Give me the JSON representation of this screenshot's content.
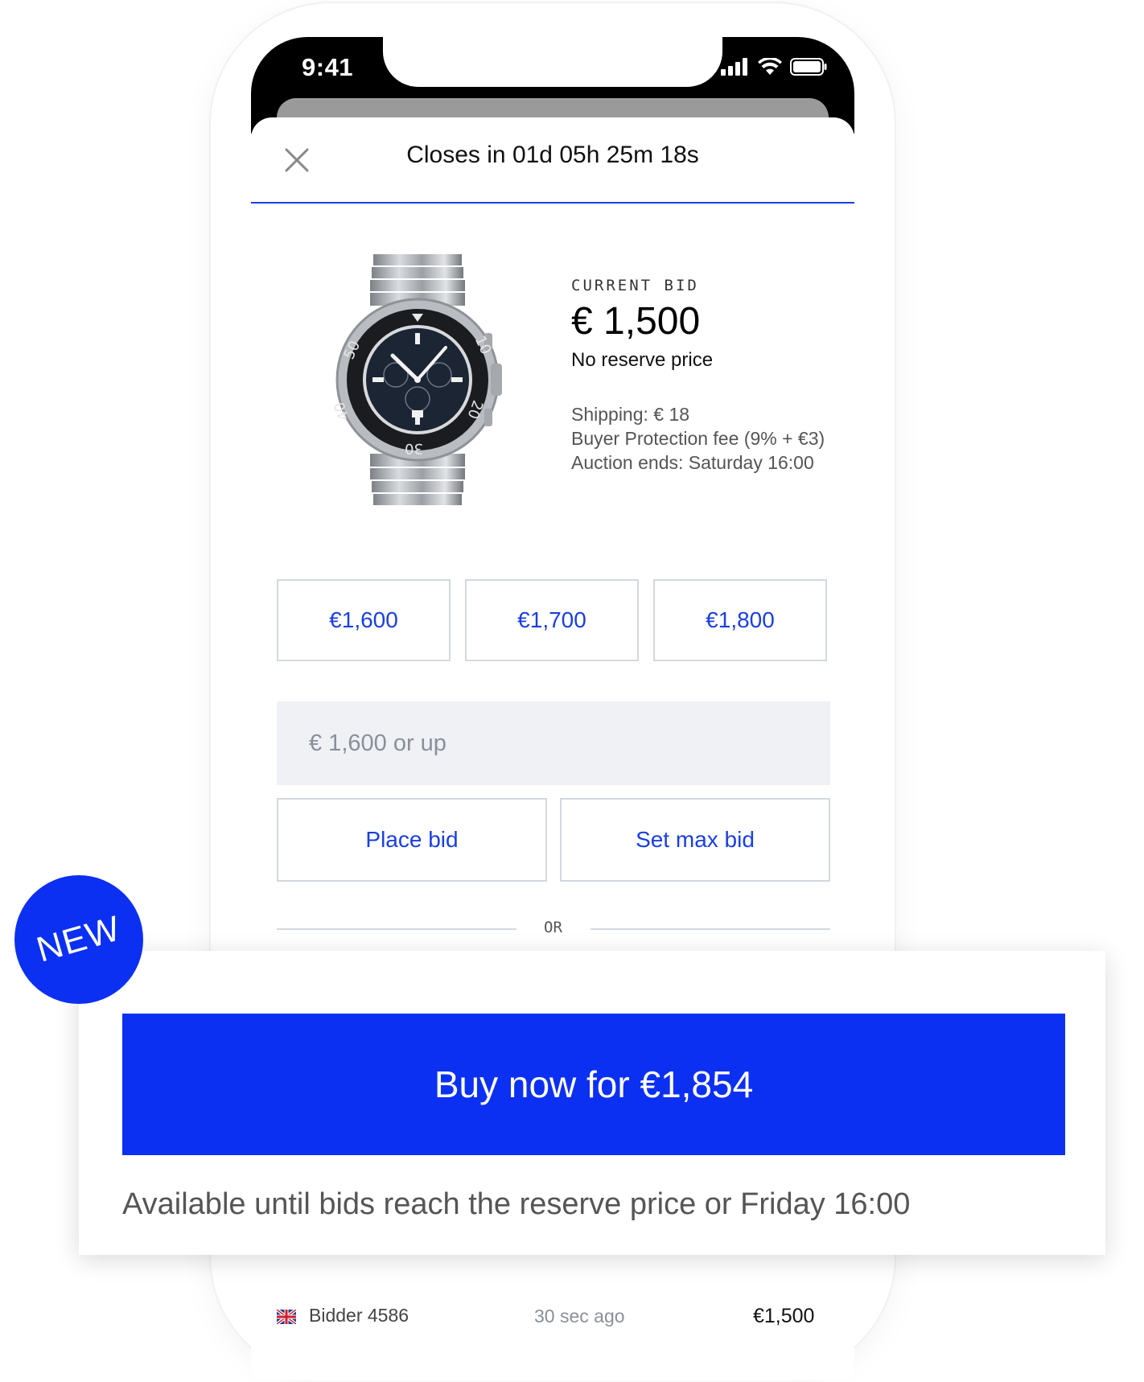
{
  "status_bar": {
    "time": "9:41",
    "icons": [
      "cellular-signal-icon",
      "wifi-icon",
      "battery-icon"
    ]
  },
  "header": {
    "close_icon": "close-icon",
    "countdown": "Closes in 01d 05h 25m 18s",
    "accent_color": "#1a3fe0"
  },
  "product": {
    "image_icon": "wristwatch-icon"
  },
  "bid_info": {
    "current_bid_label": "CURRENT BID",
    "current_bid_value": "€ 1,500",
    "reserve_text": "No reserve price",
    "shipping": "Shipping: € 18",
    "buyer_protection": "Buyer Protection fee (9% + €3)",
    "auction_ends": "Auction ends: Saturday 16:00"
  },
  "quick_bids": [
    "€1,600",
    "€1,700",
    "€1,800"
  ],
  "bid_input": {
    "placeholder": "€ 1,600 or up",
    "value": ""
  },
  "actions": {
    "place_bid": "Place bid",
    "set_max_bid": "Set max bid"
  },
  "divider": {
    "or_text": "OR"
  },
  "buy_now": {
    "badge": "NEW",
    "button_label": "Buy now for €1,854",
    "note": "Available until bids reach the reserve price or Friday 16:00",
    "brand_color": "#0c30f2"
  },
  "bid_history": [
    {
      "flag_icon": "uk-flag-icon",
      "bidder": "Bidder 4586",
      "time": "30 sec ago",
      "amount": "€1,500"
    }
  ]
}
